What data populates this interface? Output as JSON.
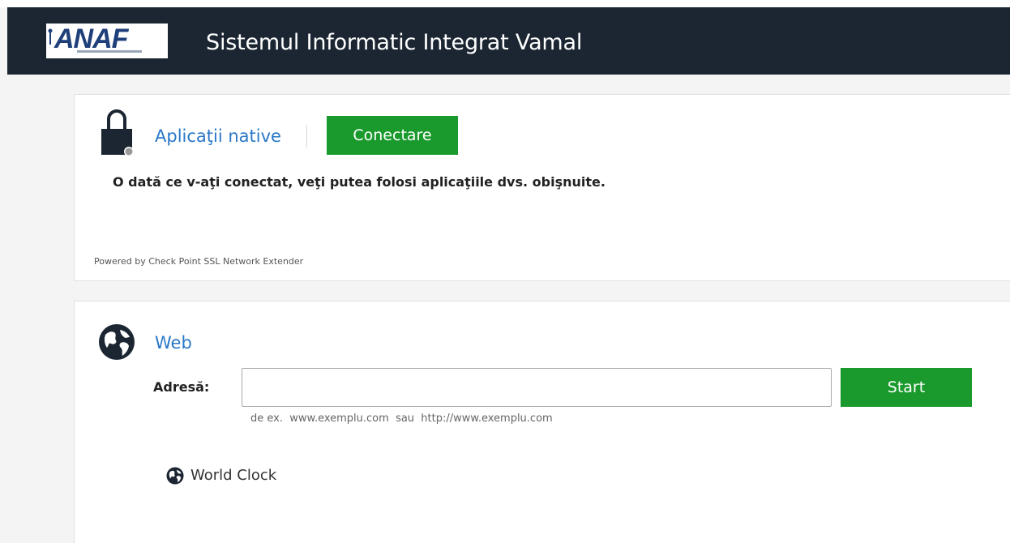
{
  "header": {
    "logo_text": "ANAF",
    "title": "Sistemul Informatic Integrat Vamal"
  },
  "native_apps": {
    "title": "Aplicaţii native",
    "connect_label": "Conectare",
    "description": "O dată ce v-aţi conectat, veţi putea folosi aplicaţiile dvs. obişnuite.",
    "powered_by": "Powered by Check Point SSL Network Extender",
    "icon": "lock-icon"
  },
  "web": {
    "title": "Web",
    "address_label": "Adresă:",
    "address_value": "",
    "start_label": "Start",
    "hint": "de ex.  www.exemplu.com  sau  http://www.exemplu.com",
    "icon": "globe-icon"
  },
  "bookmarks": [
    {
      "label": "World Clock",
      "icon": "globe-icon"
    }
  ],
  "colors": {
    "header_bg": "#1b2632",
    "accent_blue": "#2a78c7",
    "button_green": "#1a9a2d",
    "logo_blue": "#1e3f7a"
  }
}
